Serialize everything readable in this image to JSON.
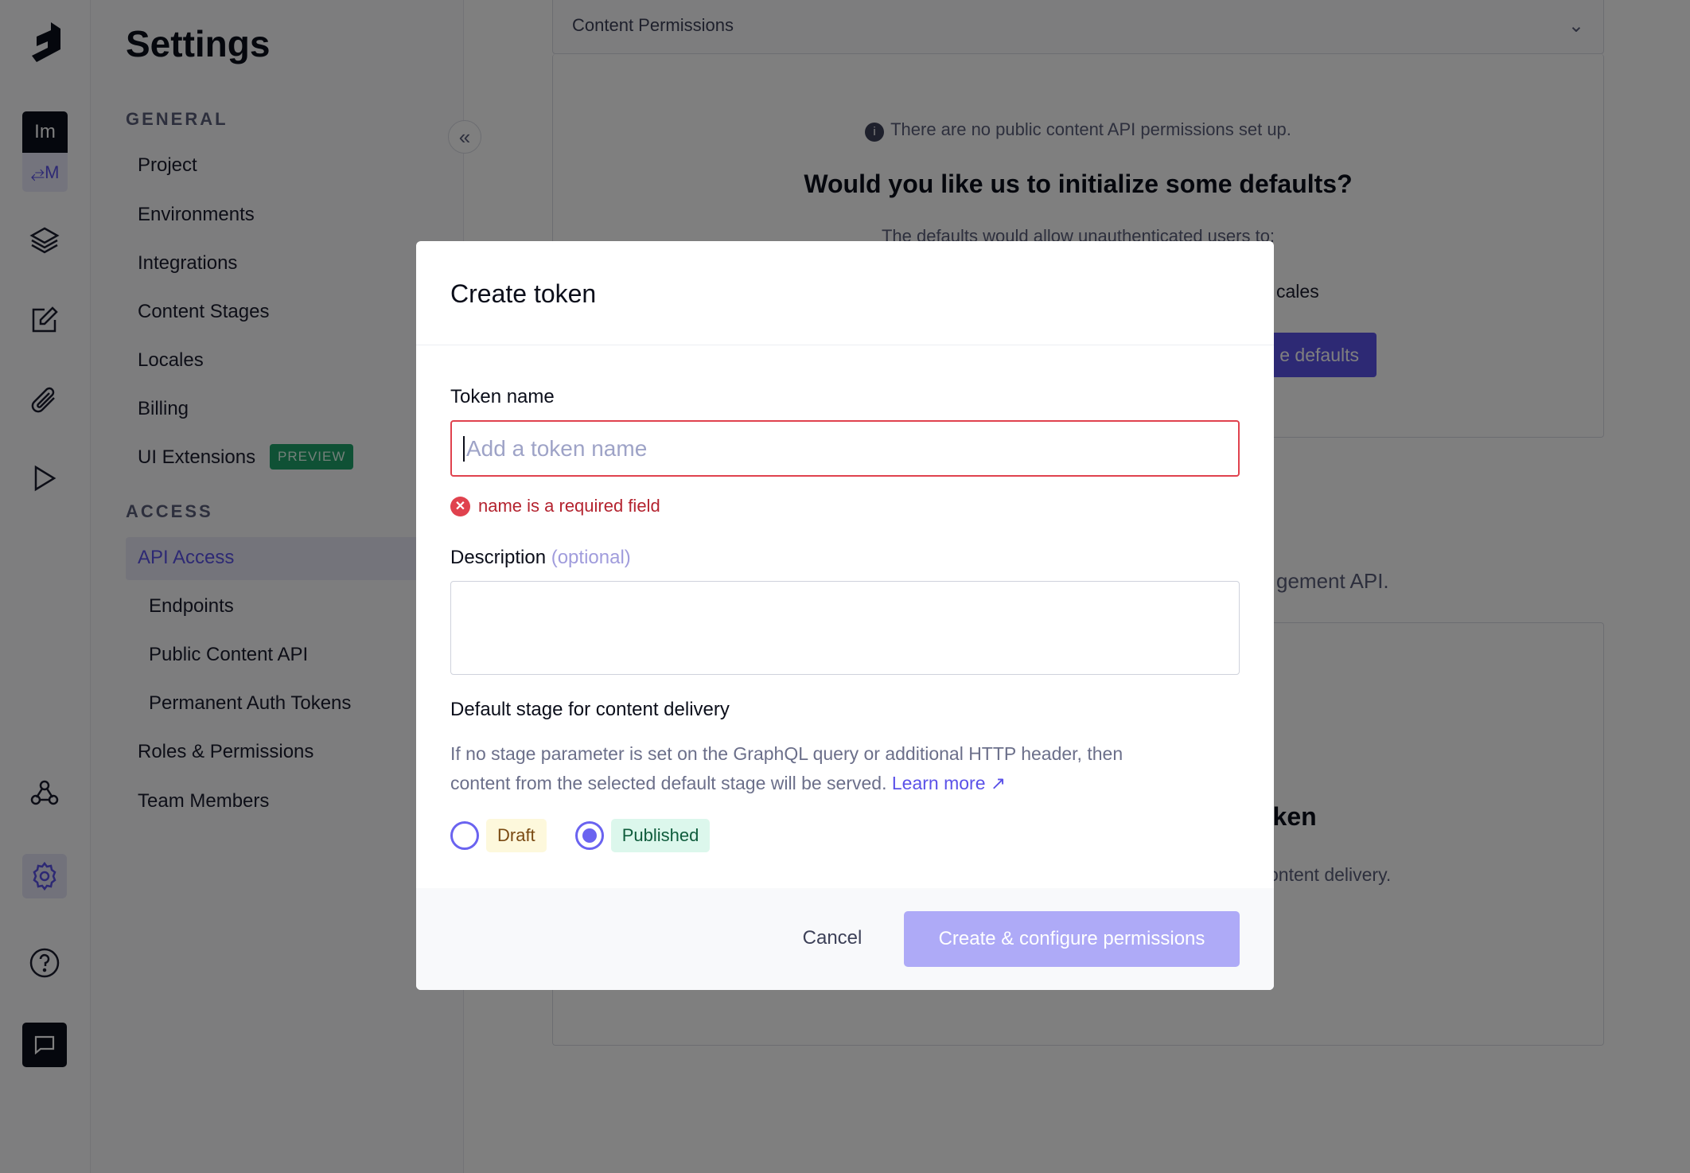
{
  "rail": {
    "project_initials": "Im",
    "env_label": "M",
    "icons": [
      "logo-icon",
      "layers-icon",
      "edit-icon",
      "paperclip-icon",
      "play-icon",
      "webhook-icon",
      "gear-icon",
      "help-icon",
      "chat-icon"
    ]
  },
  "settings": {
    "title": "Settings",
    "general_label": "GENERAL",
    "general_items": [
      "Project",
      "Environments",
      "Integrations",
      "Content Stages",
      "Locales",
      "Billing",
      "UI Extensions"
    ],
    "preview_badge": "PREVIEW",
    "access_label": "ACCESS",
    "access_items": [
      "API Access",
      "Endpoints",
      "Public Content API",
      "Permanent Auth Tokens",
      "Roles & Permissions",
      "Team Members"
    ]
  },
  "main": {
    "content_permissions": "Content Permissions",
    "info": "There are no public content API permissions set up.",
    "heading": "Would you like us to initialize some defaults?",
    "defaults_desc": "The defaults would allow unauthenticated users to:",
    "locales_fragment": "cales",
    "init_button_fragment": "e defaults",
    "mgmt_fragment": "gement API.",
    "token_fragment": "oken",
    "delivery_fragment": "ontent delivery."
  },
  "modal": {
    "title": "Create token",
    "token_name_label": "Token name",
    "token_name_placeholder": "Add a token name",
    "error": "name is a required field",
    "description_label": "Description",
    "optional": "(optional)",
    "stage_label": "Default stage for content delivery",
    "help_line1": "If no stage parameter is set on the GraphQL query or additional HTTP header, then",
    "help_line2": "content from the selected default stage will be served.",
    "learn_more": "Learn more",
    "stages": [
      {
        "label": "Draft",
        "selected": false
      },
      {
        "label": "Published",
        "selected": true
      }
    ],
    "cancel": "Cancel",
    "submit": "Create & configure permissions"
  },
  "colors": {
    "accent": "#5b52e8",
    "error": "#e0424e",
    "draft_bg": "#fdf8dc",
    "published_bg": "#dcf7ec"
  }
}
